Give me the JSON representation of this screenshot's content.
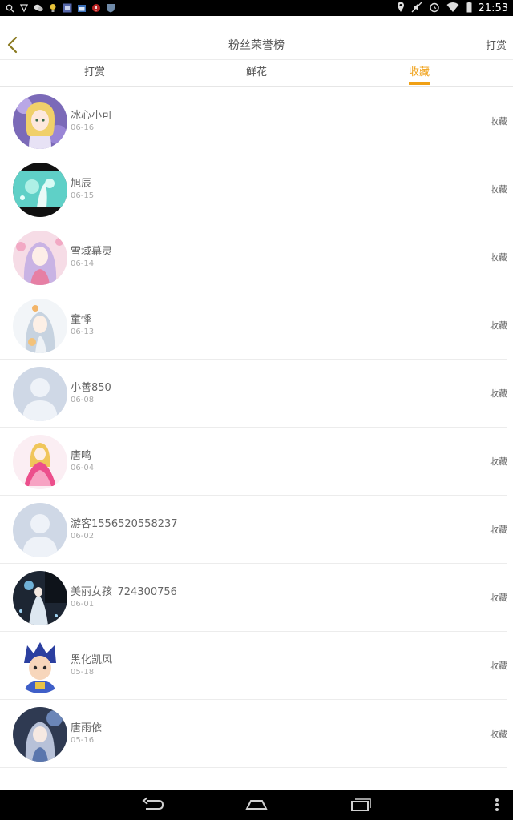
{
  "status_bar": {
    "time": "21:53"
  },
  "header": {
    "title": "粉丝荣誉榜",
    "right_action": "打赏"
  },
  "tabs": [
    {
      "label": "打赏",
      "active": false
    },
    {
      "label": "鲜花",
      "active": false
    },
    {
      "label": "收藏",
      "active": true
    }
  ],
  "accent_color": "#f0a015",
  "list": [
    {
      "name": "冰心小可",
      "date": "06-16",
      "action": "收藏",
      "avatar": "anime-girl-purple"
    },
    {
      "name": "旭辰",
      "date": "06-15",
      "action": "收藏",
      "avatar": "anime-scene-teal"
    },
    {
      "name": "雪域幕灵",
      "date": "06-14",
      "action": "收藏",
      "avatar": "anime-girl-pink"
    },
    {
      "name": "童悸",
      "date": "06-13",
      "action": "收藏",
      "avatar": "anime-girl-white"
    },
    {
      "name": "小善850",
      "date": "06-08",
      "action": "收藏",
      "avatar": "default-user"
    },
    {
      "name": "唐鸣",
      "date": "06-04",
      "action": "收藏",
      "avatar": "anime-girl-dress"
    },
    {
      "name": "游客1556520558237",
      "date": "06-02",
      "action": "收藏",
      "avatar": "default-user"
    },
    {
      "name": "美丽女孩_724300756",
      "date": "06-01",
      "action": "收藏",
      "avatar": "anime-girl-dark"
    },
    {
      "name": "黑化凯风",
      "date": "05-18",
      "action": "收藏",
      "avatar": "anime-boy-blue"
    },
    {
      "name": "唐雨依",
      "date": "05-16",
      "action": "收藏",
      "avatar": "anime-girl-night"
    }
  ]
}
